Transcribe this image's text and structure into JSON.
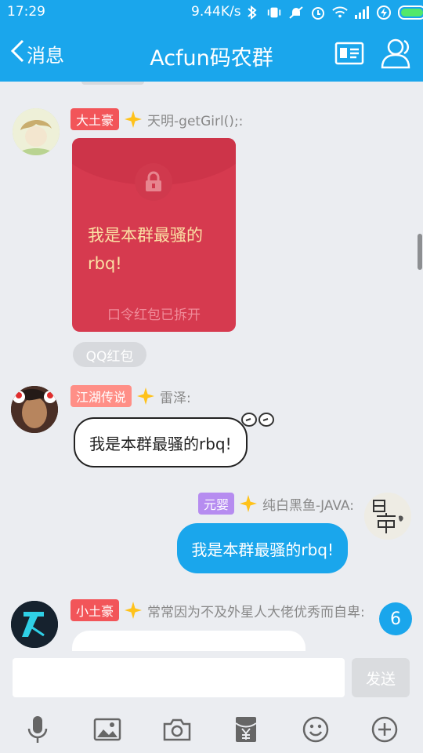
{
  "status_bar": {
    "time": "17:29",
    "network_speed": "9.44K/s",
    "battery_color": "#52e86b"
  },
  "header": {
    "back_label": "消息",
    "title": "Acfun码农群",
    "background_color": "#1aa6ec",
    "icons": [
      "back-chevron-icon",
      "group-card-icon",
      "group-members-icon"
    ]
  },
  "messages": [
    {
      "badge": "大土豪",
      "badge_color": "#f25559",
      "sender": "天明-getGirl();:",
      "type": "red_packet",
      "packet": {
        "text": "我是本群最骚的rbq!",
        "note": "口令红包已拆开",
        "tag": "QQ红包"
      }
    },
    {
      "badge": "江湖传说",
      "badge_color": "#ff8f87",
      "sender": "雷泽:",
      "text": "我是本群最骚的rbq!",
      "side": "left"
    },
    {
      "badge": "元婴",
      "badge_color": "#b68cf0",
      "sender": "纯白黑鱼-JAVA:",
      "text": "我是本群最骚的rbq!",
      "side": "right"
    },
    {
      "badge": "小土豪",
      "badge_color": "#f25559",
      "sender": "常常因为不及外星人大佬优秀而自卑:",
      "side": "left",
      "partial": true
    }
  ],
  "unread_count": "6",
  "input": {
    "value": "",
    "placeholder": ""
  },
  "send_label": "发送",
  "toolbar": {
    "icons": [
      "microphone-icon",
      "image-icon",
      "camera-icon",
      "red-packet-icon",
      "emoji-icon",
      "plus-icon"
    ]
  }
}
